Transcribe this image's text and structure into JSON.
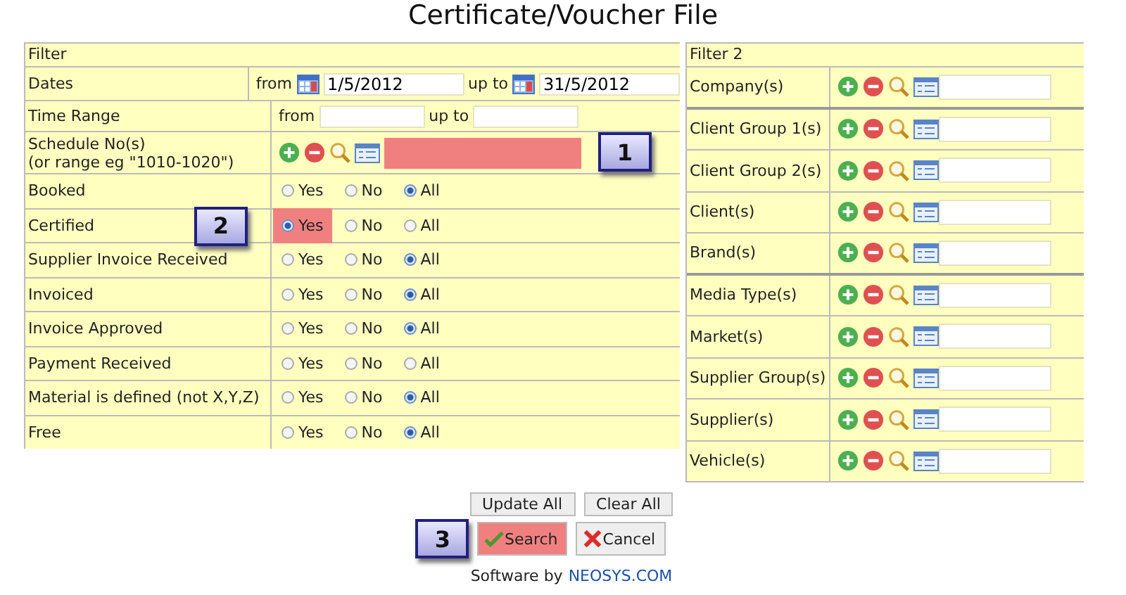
{
  "title": "Certificate/Voucher File",
  "filter": {
    "heading": "Filter",
    "dates": {
      "label": "Dates",
      "from_label": "from",
      "from": "1/5/2012",
      "to_label": "up to",
      "to": "31/5/2012"
    },
    "time_range": {
      "label": "Time Range",
      "from_label": "from",
      "to_label": "up to"
    },
    "schedule": {
      "label": "Schedule No(s)",
      "hint": "(or range eg \"1010-1020\")",
      "highlighted": true,
      "callout": "1"
    },
    "flags": [
      {
        "label": "Booked",
        "options": [
          {
            "label": "Yes",
            "selected": false,
            "highlighted": false
          },
          {
            "label": "No",
            "selected": false,
            "highlighted": false
          },
          {
            "label": "All",
            "selected": true,
            "highlighted": false
          }
        ]
      },
      {
        "label": "Certified",
        "callout": "2",
        "options": [
          {
            "label": "Yes",
            "selected": true,
            "highlighted": true
          },
          {
            "label": "No",
            "selected": false,
            "highlighted": false
          },
          {
            "label": "All",
            "selected": false,
            "highlighted": false
          }
        ]
      },
      {
        "label": "Supplier Invoice Received",
        "options": [
          {
            "label": "Yes",
            "selected": false,
            "highlighted": false
          },
          {
            "label": "No",
            "selected": false,
            "highlighted": false
          },
          {
            "label": "All",
            "selected": true,
            "highlighted": false
          }
        ]
      },
      {
        "label": "Invoiced",
        "options": [
          {
            "label": "Yes",
            "selected": false,
            "highlighted": false
          },
          {
            "label": "No",
            "selected": false,
            "highlighted": false
          },
          {
            "label": "All",
            "selected": true,
            "highlighted": false
          }
        ]
      },
      {
        "label": "Invoice Approved",
        "options": [
          {
            "label": "Yes",
            "selected": false,
            "highlighted": false
          },
          {
            "label": "No",
            "selected": false,
            "highlighted": false
          },
          {
            "label": "All",
            "selected": true,
            "highlighted": false
          }
        ]
      },
      {
        "label": "Payment Received",
        "options": [
          {
            "label": "Yes",
            "selected": false,
            "highlighted": false
          },
          {
            "label": "No",
            "selected": false,
            "highlighted": false
          },
          {
            "label": "All",
            "selected": false,
            "highlighted": false
          }
        ]
      },
      {
        "label": "Material is defined (not X,Y,Z)",
        "options": [
          {
            "label": "Yes",
            "selected": false,
            "highlighted": false
          },
          {
            "label": "No",
            "selected": false,
            "highlighted": false
          },
          {
            "label": "All",
            "selected": true,
            "highlighted": false
          }
        ]
      },
      {
        "label": "Free",
        "options": [
          {
            "label": "Yes",
            "selected": false,
            "highlighted": false
          },
          {
            "label": "No",
            "selected": false,
            "highlighted": false
          },
          {
            "label": "All",
            "selected": true,
            "highlighted": false
          }
        ]
      }
    ]
  },
  "filter2": {
    "heading": "Filter 2",
    "rows": [
      {
        "label": "Company(s)",
        "group_end": true
      },
      {
        "label": "Client Group 1(s)",
        "group_end": false
      },
      {
        "label": "Client Group 2(s)",
        "group_end": false
      },
      {
        "label": "Client(s)",
        "group_end": false
      },
      {
        "label": "Brand(s)",
        "group_end": true
      },
      {
        "label": "Media Type(s)",
        "group_end": false
      },
      {
        "label": "Market(s)",
        "group_end": false
      },
      {
        "label": "Supplier Group(s)",
        "group_end": false
      },
      {
        "label": "Supplier(s)",
        "group_end": false
      },
      {
        "label": "Vehicle(s)",
        "group_end": false
      }
    ]
  },
  "buttons": [
    {
      "label": "Update All"
    },
    {
      "label": "Clear All"
    }
  ],
  "actions": [
    {
      "label": "Search",
      "kind": "search",
      "highlighted": true,
      "callout": "3"
    },
    {
      "label": "Cancel",
      "kind": "cancel",
      "highlighted": false
    }
  ],
  "footer": {
    "text": "Software by",
    "link": "NEOSYS.COM"
  }
}
